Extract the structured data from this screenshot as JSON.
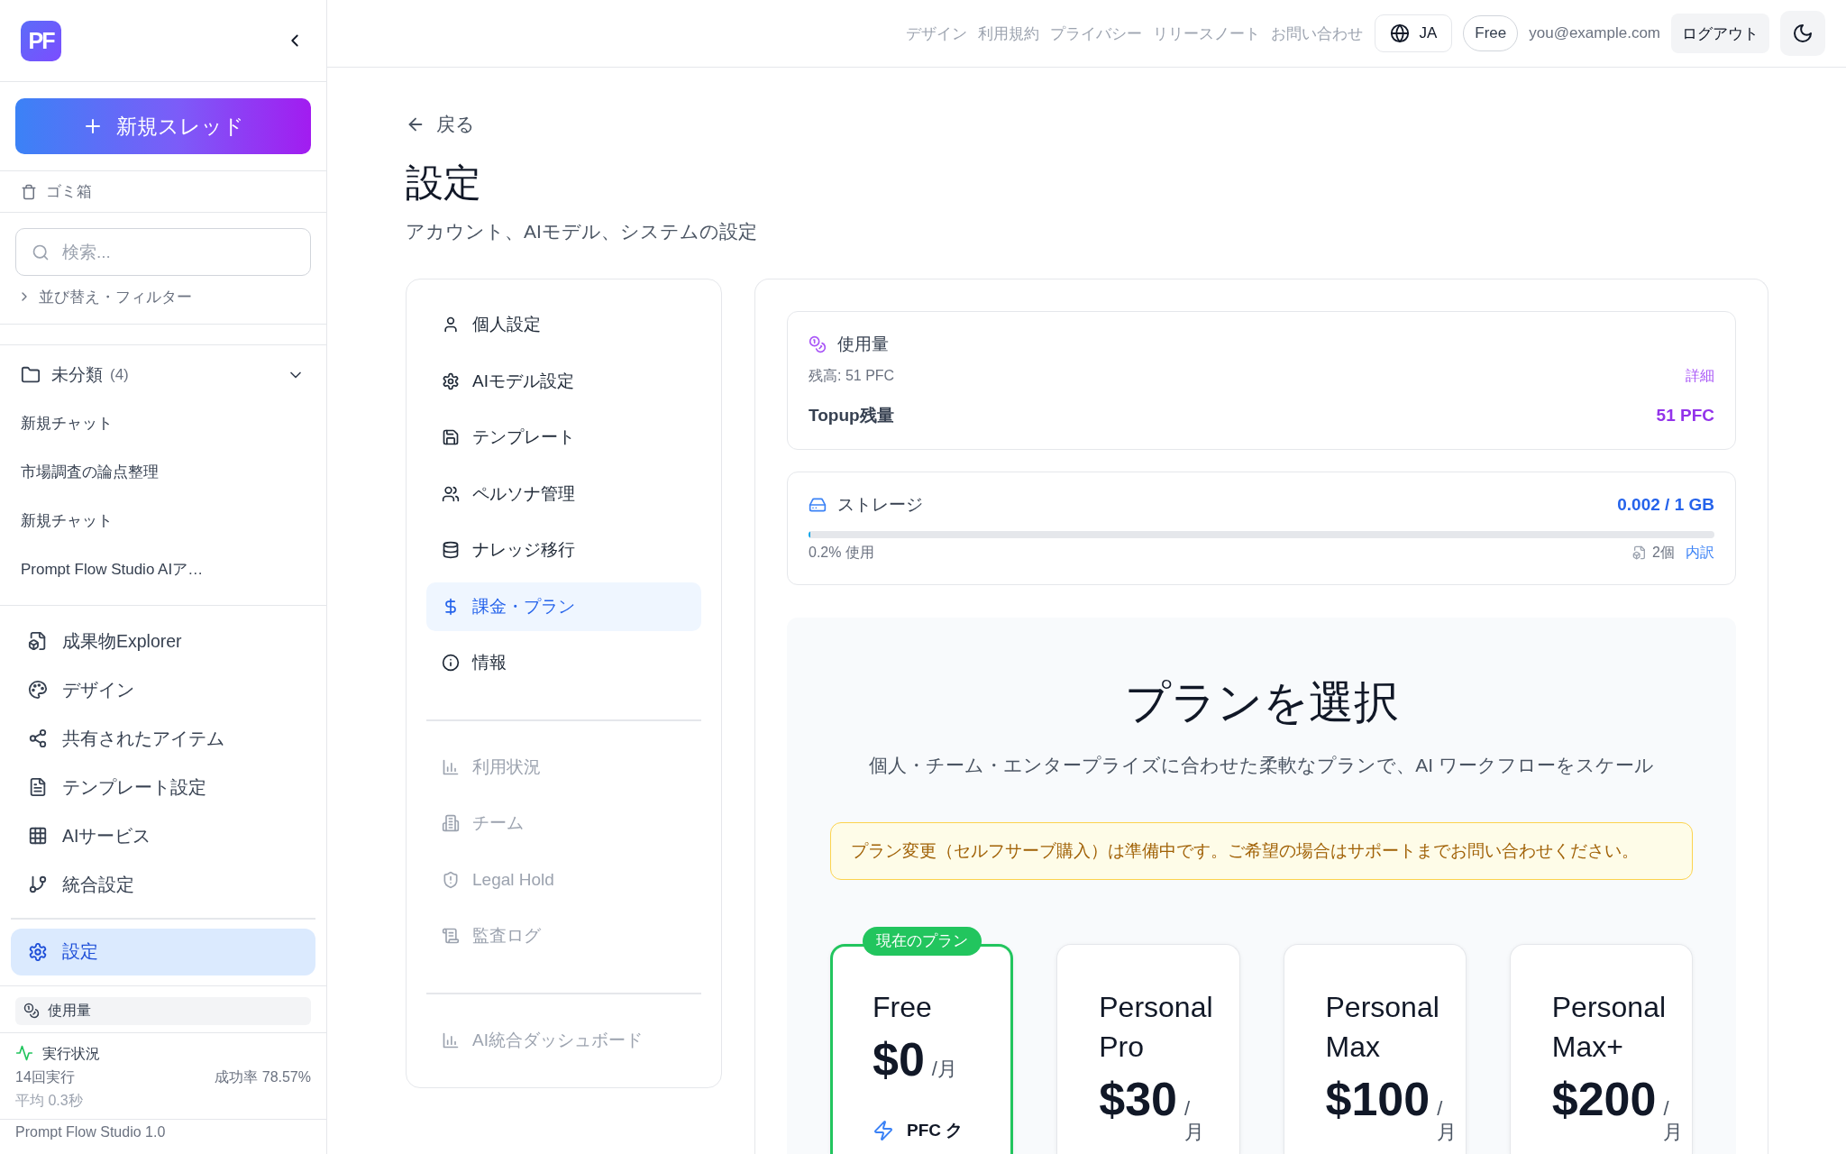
{
  "header": {
    "links": [
      "デザイン",
      "利用規約",
      "プライバシー",
      "リリースノート",
      "お問い合わせ"
    ],
    "language": "JA",
    "plan": "Free",
    "email": "you@example.com",
    "logout": "ログアウト"
  },
  "sidebar": {
    "logo": "PF",
    "new_thread": "新規スレッド",
    "trash": "ゴミ箱",
    "search": {
      "placeholder": "検索..."
    },
    "sort_filter": {
      "label": "並び替え・フィルター",
      "expanded": false
    },
    "folders": [
      {
        "name": "未分類",
        "count": "(4)",
        "expanded": true,
        "chats": [
          "新規チャット",
          "市場調査の論点整理",
          "新規チャット",
          "Prompt Flow Studio AIア…"
        ]
      }
    ],
    "nav": [
      {
        "label": "成果物Explorer",
        "selected": false
      },
      {
        "label": "デザイン",
        "selected": false
      },
      {
        "label": "共有されたアイテム",
        "selected": false
      },
      {
        "label": "テンプレート設定",
        "selected": false
      },
      {
        "label": "AIサービス",
        "selected": false
      },
      {
        "label": "統合設定",
        "selected": false
      }
    ],
    "footer_nav": [
      {
        "label": "設定",
        "selected": true
      }
    ],
    "usage": "使用量",
    "run_status": {
      "title": "実行状況",
      "runs": "14回実行",
      "success_rate": "成功率 78.57%",
      "average": "平均 0.3秒"
    },
    "version": "Prompt Flow Studio 1.0"
  },
  "page": {
    "back": "戻る",
    "title": "設定",
    "subtitle": "アカウント、AIモデル、システムの設定"
  },
  "settings_nav": [
    {
      "items": [
        {
          "label": "個人設定",
          "selected": false,
          "disabled": false
        },
        {
          "label": "AIモデル設定",
          "selected": false,
          "disabled": false
        },
        {
          "label": "テンプレート",
          "selected": false,
          "disabled": false
        },
        {
          "label": "ペルソナ管理",
          "selected": false,
          "disabled": false
        },
        {
          "label": "ナレッジ移行",
          "selected": false,
          "disabled": false
        },
        {
          "label": "課金・プラン",
          "selected": true,
          "disabled": false
        },
        {
          "label": "情報",
          "selected": false,
          "disabled": false
        }
      ]
    },
    {
      "items": [
        {
          "label": "利用状況",
          "selected": false,
          "disabled": true
        },
        {
          "label": "チーム",
          "selected": false,
          "disabled": true
        },
        {
          "label": "Legal Hold",
          "selected": false,
          "disabled": true
        },
        {
          "label": "監査ログ",
          "selected": false,
          "disabled": true
        }
      ]
    },
    {
      "items": [
        {
          "label": "AI統合ダッシュボード",
          "selected": false,
          "disabled": true
        }
      ]
    }
  ],
  "usage": {
    "title": "使用量",
    "balance": "残高: 51 PFC",
    "details_link": "詳細",
    "topup_label": "Topup残量",
    "topup_value": "51 PFC"
  },
  "storage": {
    "title": "ストレージ",
    "amount": "0.002 / 1 GB",
    "level": 0.002,
    "used": "0.2% 使用",
    "files": "2個",
    "breakdown_link": "内訳"
  },
  "plans": {
    "title": "プランを選択",
    "subtitle": "個人・チーム・エンタープライズに合わせた柔軟なプランで、AI ワークフローをスケール",
    "notice": "プラン変更（セルフサーブ購入）は準備中です。ご希望の場合はサポートまでお問い合わせください。",
    "current_badge": "現在のプラン",
    "items": [
      {
        "name": "Free",
        "price": "$0",
        "period": "/月",
        "current": true,
        "features": [
          "PFC ク"
        ]
      },
      {
        "name": "Personal Pro",
        "price": "$30",
        "period": "/月",
        "current": false
      },
      {
        "name": "Personal Max",
        "price": "$100",
        "period": "/月",
        "current": false
      },
      {
        "name": "Personal Max+",
        "price": "$200",
        "period": "/月",
        "current": false
      }
    ]
  }
}
